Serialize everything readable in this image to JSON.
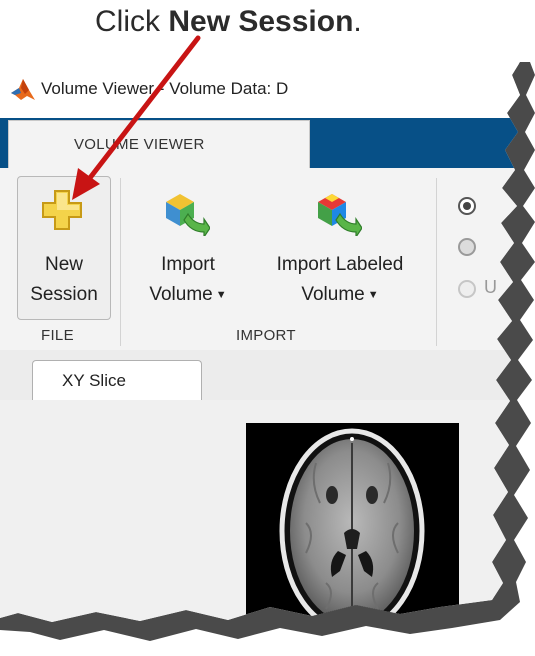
{
  "caption": {
    "prefix": "Click ",
    "bold": "New Session",
    "suffix": "."
  },
  "window": {
    "title": "Volume Viewer - Volume Data: D"
  },
  "ribbon": {
    "tab_label": "VOLUME VIEWER",
    "file_group": {
      "label": "FILE",
      "new_session": {
        "line1": "New",
        "line2": "Session"
      }
    },
    "import_group": {
      "label": "IMPORT",
      "import_volume": {
        "line1": "Import",
        "line2": "Volume"
      },
      "import_labeled": {
        "line1": "Import Labeled",
        "line2": "Volume"
      }
    },
    "partial_radio_label": "U"
  },
  "document": {
    "tab_label": "XY Slice"
  },
  "colors": {
    "tabstrip": "#075087",
    "arrow": "#c81414",
    "ribbon_bg": "#f3f3f3"
  }
}
